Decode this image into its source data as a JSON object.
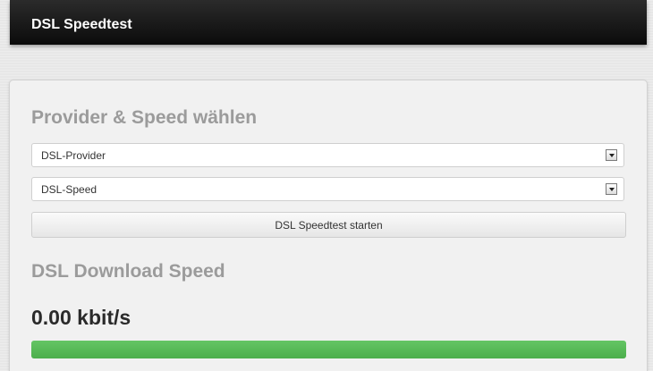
{
  "header": {
    "title": "DSL Speedtest"
  },
  "provider_section": {
    "title": "Provider & Speed wählen",
    "provider_select": {
      "value": "DSL-Provider"
    },
    "speed_select": {
      "value": "DSL-Speed"
    },
    "start_button_label": "DSL Speedtest starten"
  },
  "download_section": {
    "title": "DSL Download Speed",
    "speed_value": "0.00 kbit/s",
    "progress_percent": 100,
    "progress_color": "#5cb85c"
  },
  "colors": {
    "header_bg": "#111111",
    "section_title": "#9b9b9b",
    "panel_bg": "#f1f1f1"
  },
  "icons": [
    "dropdown-arrow-icon"
  ]
}
